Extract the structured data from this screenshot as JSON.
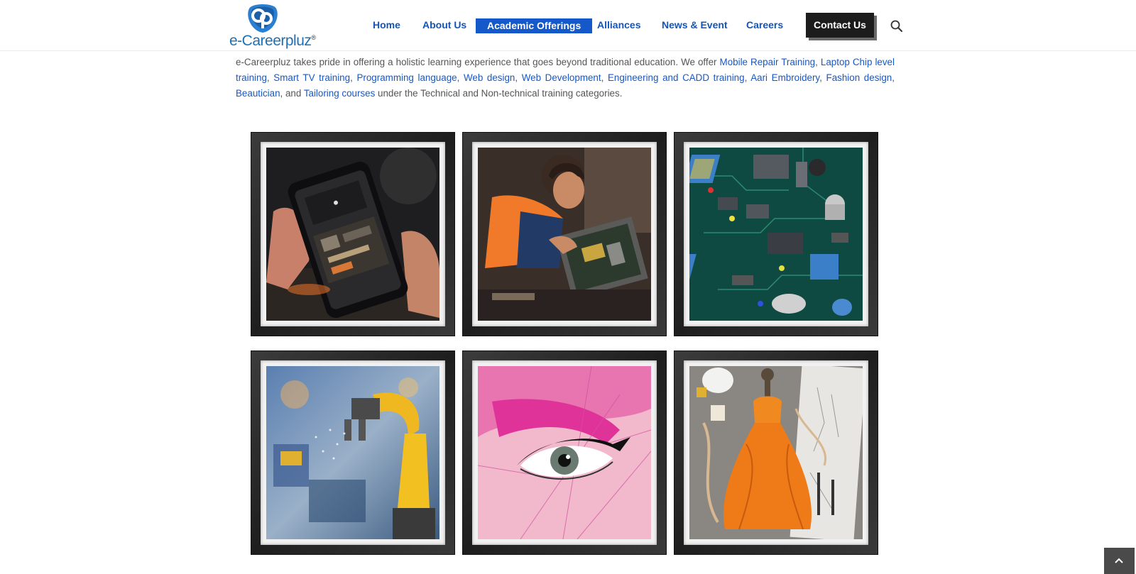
{
  "header": {
    "logo_text": "e-Careerpluz",
    "logo_mark": "cp",
    "nav": [
      {
        "label": "Home",
        "active": false
      },
      {
        "label": "About Us",
        "active": false
      },
      {
        "label": "Academic Offerings",
        "active": true
      },
      {
        "label": "Alliances",
        "active": false
      },
      {
        "label": "News & Event",
        "active": false
      },
      {
        "label": "Careers",
        "active": false
      }
    ],
    "contact_label": "Contact Us",
    "search_icon": "search-icon"
  },
  "intro": {
    "lead": "e-Careerpluz takes pride in offering a holistic learning experience that goes beyond traditional education. We offer ",
    "links": [
      "Mobile Repair Training",
      "Laptop Chip level training",
      "Smart TV training",
      "Programming language",
      "Web design",
      "Web Development",
      "Engineering and CADD training",
      "Aari Embroidery",
      "Fashion design",
      "Beautician",
      "Tailoring courses"
    ],
    "sep": ", ",
    "and": ", and ",
    "tail": " under the Technical and Non-technical training categories."
  },
  "gallery": [
    {
      "name": "mobile-repair-photo"
    },
    {
      "name": "laptop-repair-photo"
    },
    {
      "name": "circuit-board-photo"
    },
    {
      "name": "robotic-arm-photo"
    },
    {
      "name": "eye-makeup-photo"
    },
    {
      "name": "fashion-dress-photo"
    }
  ],
  "colors": {
    "link": "#1558c9",
    "nav_text": "#1455b8",
    "active_bg": "#1558c9",
    "contact_bg": "#1c1c1c"
  },
  "back_to_top_icon": "chevron-up-icon"
}
